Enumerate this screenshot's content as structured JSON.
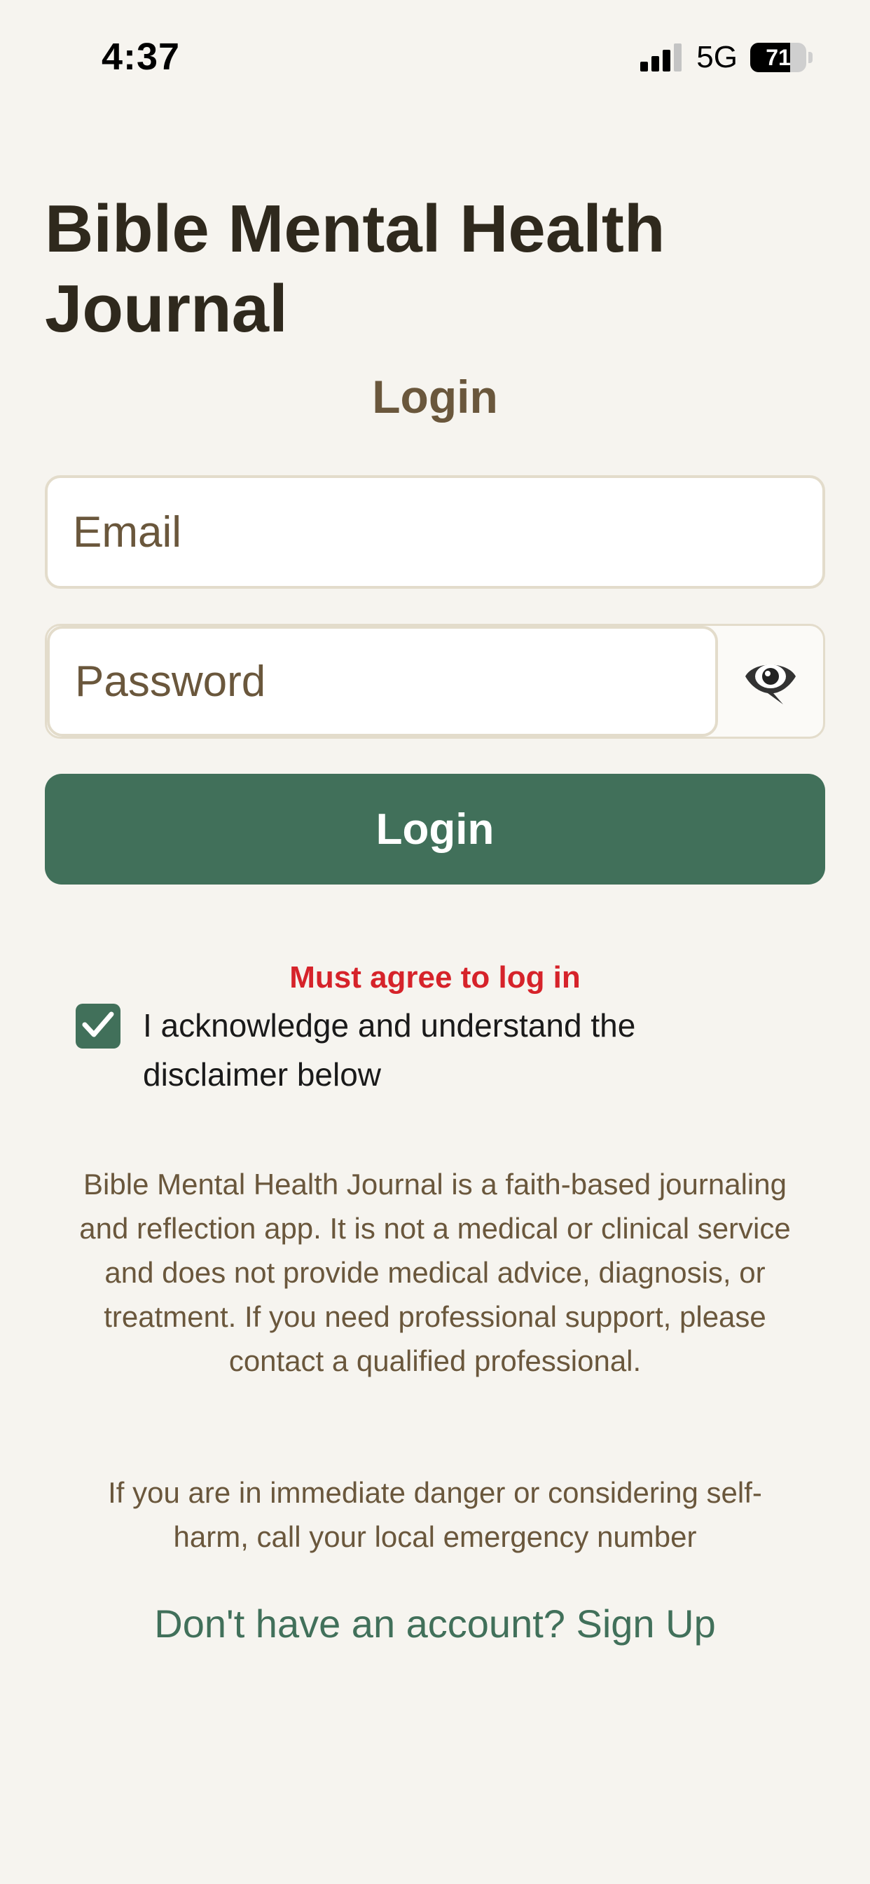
{
  "status_bar": {
    "time": "4:37",
    "network": "5G",
    "battery_level": "71",
    "battery_fraction": 0.71,
    "signal_bars_active": 3,
    "signal_bars_total": 4
  },
  "header": {
    "app_title": "Bible Mental Health Journal",
    "subtitle": "Login"
  },
  "form": {
    "email_placeholder": "Email",
    "email_value": "",
    "password_placeholder": "Password",
    "password_value": "",
    "visibility_icon": "eye-icon",
    "login_label": "Login"
  },
  "agreement": {
    "error": "Must agree to log in",
    "checked": true,
    "label": "I acknowledge and understand the disclaimer below"
  },
  "disclaimer": {
    "body": "Bible Mental Health Journal is a faith-based journaling and reflection app. It is not a medical or clinical service and does not provide medical advice, diagnosis, or treatment. If you need professional support, please contact a qualified professional.",
    "emergency": "If you are in immediate danger or considering self-harm, call your local emergency number"
  },
  "footer": {
    "signup_text": "Don't have an account? Sign Up"
  },
  "colors": {
    "background": "#f6f4ef",
    "primary": "#41705a",
    "title": "#2f291d",
    "muted": "#6a573c",
    "error": "#d6232a",
    "border": "#e3dccb"
  }
}
